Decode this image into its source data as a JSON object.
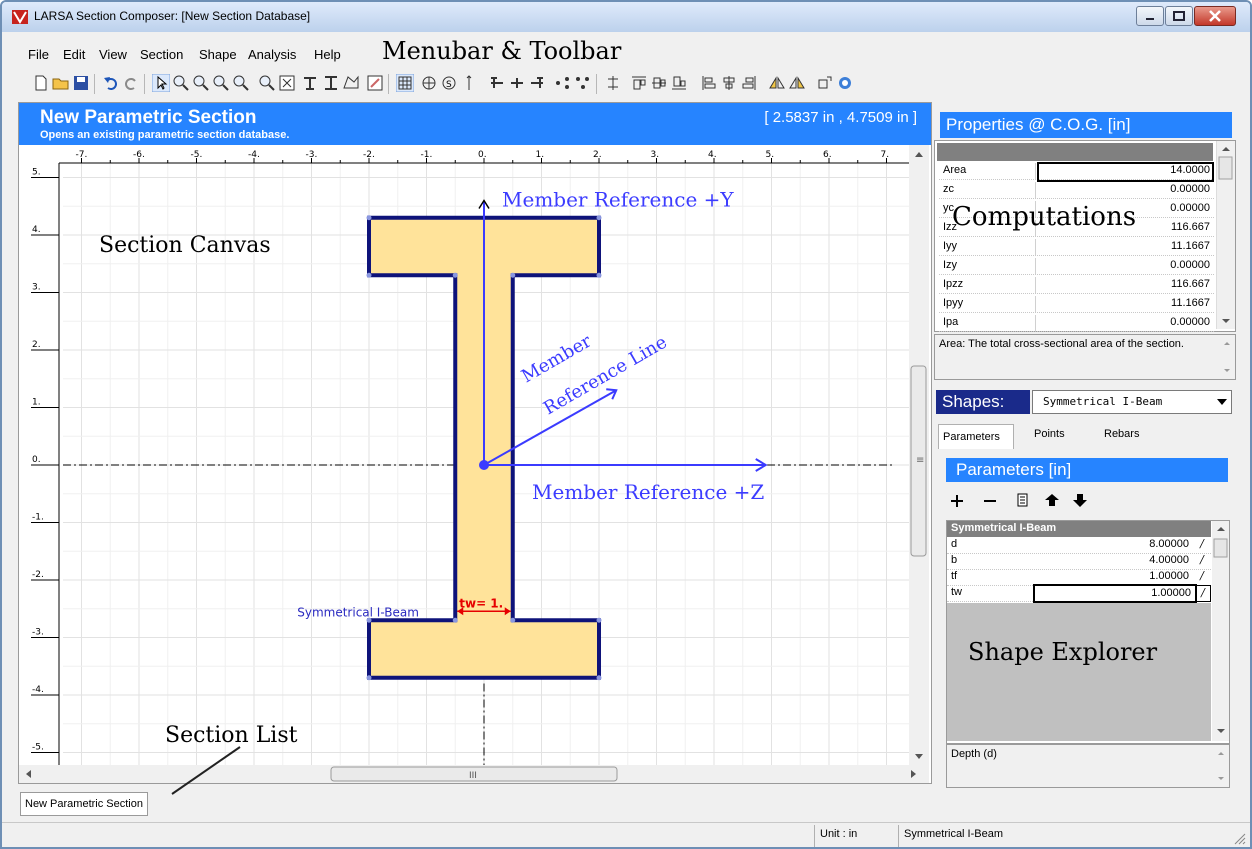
{
  "window": {
    "title": "LARSA Section Composer: [New Section Database]"
  },
  "menu": {
    "items": [
      "File",
      "Edit",
      "View",
      "Section",
      "Shape",
      "Analysis",
      "Help"
    ]
  },
  "annotations": {
    "menubar_toolbar": "Menubar & Toolbar",
    "section_canvas": "Section Canvas",
    "computations": "Computations",
    "shape_explorer": "Shape Explorer",
    "section_list": "Section List",
    "member_ref_y": "Member Reference +Y",
    "member_ref_z": "Member Reference +Z",
    "member_ref_line_1": "Member",
    "member_ref_line_2": "Reference Line"
  },
  "canvas": {
    "header_title": "New Parametric Section",
    "header_subtitle": "Opens an existing parametric section database.",
    "cursor_coords": "[ 2.5837 in , 4.7509 in ]",
    "x_ticks": [
      "-7.",
      "-6.",
      "-5.",
      "-4.",
      "-3.",
      "-2.",
      "-1.",
      "0.",
      "1.",
      "2.",
      "3.",
      "4.",
      "5.",
      "6.",
      "7."
    ],
    "y_ticks": [
      "5.",
      "4.",
      "3.",
      "2.",
      "1.",
      "0.",
      "-1.",
      "-2.",
      "-3.",
      "-4.",
      "-5."
    ],
    "shape_label": "Symmetrical I-Beam",
    "dimension_label": "tw= 1.",
    "hscroll_grip": "III",
    "vscroll_grip": "≡",
    "colors": {
      "shape_fill": "#ffe39a",
      "shape_outline": "#0e137a",
      "reference": "#3b3bff",
      "dimension": "#e60000",
      "header": "#2684ff"
    }
  },
  "section_list": {
    "items": [
      "New Parametric Section"
    ]
  },
  "statusbar": {
    "unit": "Unit : in",
    "shape": "Symmetrical I-Beam"
  },
  "properties": {
    "title": "Properties @ C.O.G. [in]",
    "rows": [
      {
        "name": "Area",
        "value": "14.0000"
      },
      {
        "name": "zc",
        "value": "0.00000"
      },
      {
        "name": "yc",
        "value": "0.00000"
      },
      {
        "name": "Izz",
        "value": "116.667"
      },
      {
        "name": "Iyy",
        "value": "11.1667"
      },
      {
        "name": "Izy",
        "value": "0.00000"
      },
      {
        "name": "Ipzz",
        "value": "116.667"
      },
      {
        "name": "Ipyy",
        "value": "11.1667"
      },
      {
        "name": "Ipa",
        "value": "0.00000"
      }
    ],
    "description": "Area: The total cross-sectional area of the section."
  },
  "shapes": {
    "label": "Shapes:",
    "selected": "Symmetrical I-Beam",
    "tabs": [
      "Parameters",
      "Points",
      "Rebars"
    ]
  },
  "parameters": {
    "title": "Parameters [in]",
    "group": "Symmetrical I-Beam",
    "rows": [
      {
        "name": "d",
        "value": "8.00000"
      },
      {
        "name": "b",
        "value": "4.00000"
      },
      {
        "name": "tf",
        "value": "1.00000"
      },
      {
        "name": "tw",
        "value": "1.00000"
      }
    ],
    "description": "Depth (d)"
  }
}
